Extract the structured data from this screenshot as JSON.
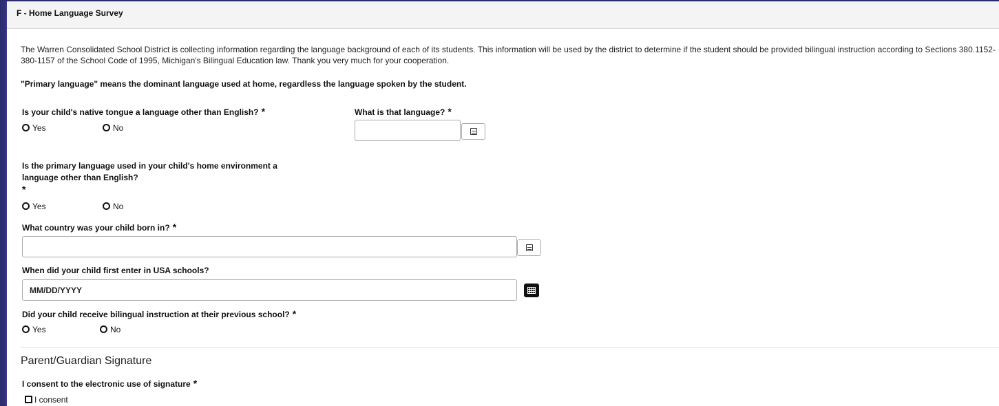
{
  "panel": {
    "title": "F - Home Language Survey"
  },
  "intro": {
    "text": "The Warren Consolidated School District is collecting information regarding the language background of each of its students. This information will be used by the district to determine if the student should be provided bilingual instruction according to Sections 380.1152-380-1157 of the School Code of 1995, Michigan's Bilingual Education law. Thank you very much for your cooperation.",
    "note": "\"Primary language\" means the dominant language used at home, regardless the language spoken by the student."
  },
  "questions": {
    "native_tongue": {
      "label": "Is your child's native tongue a language other than English?",
      "required": "*",
      "yes": "Yes",
      "no": "No"
    },
    "which_language": {
      "label": "What is that language?",
      "required": "*",
      "value": ""
    },
    "primary_language": {
      "label_line1": "Is the primary language used in your child's home environment a",
      "label_line2": "language other than English?",
      "required": "*",
      "yes": "Yes",
      "no": "No"
    },
    "birth_country": {
      "label": "What country was your child born in?",
      "required": "*",
      "value": ""
    },
    "first_entry": {
      "label": "When did your child first enter in USA schools?",
      "placeholder": "MM/DD/YYYY",
      "value": ""
    },
    "bilingual_instruction": {
      "label": "Did your child receive bilingual instruction at their previous school?",
      "required": "*",
      "yes": "Yes",
      "no": "No"
    }
  },
  "signature": {
    "section_title": "Parent/Guardian Signature",
    "consent_label": "I consent to the electronic use of signature",
    "required": "*",
    "checkbox_label": "I consent"
  },
  "icons": {
    "list_picker": "list-picker-icon",
    "calendar": "calendar-icon"
  }
}
